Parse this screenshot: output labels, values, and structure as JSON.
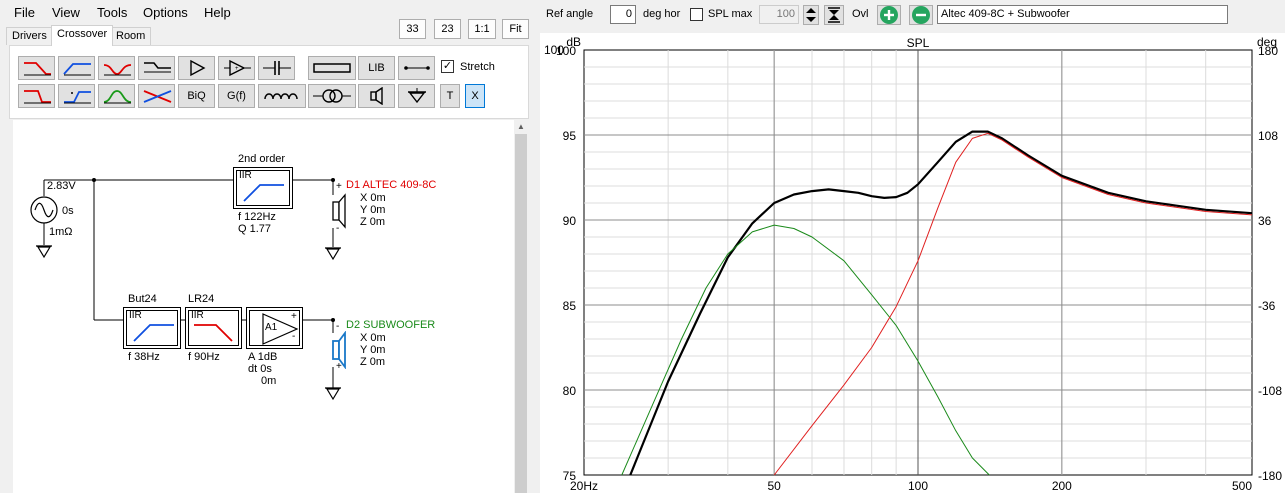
{
  "menu": {
    "file": "File",
    "view": "View",
    "tools": "Tools",
    "options": "Options",
    "help": "Help"
  },
  "small_buttons": {
    "zoom_a": "33",
    "zoom_b": "23",
    "one_to_one": "1:1",
    "fit": "Fit"
  },
  "tabs": [
    "Drivers",
    "Crossover",
    "Room"
  ],
  "toolbar": {
    "lib": "LIB",
    "biq": "BiQ",
    "gf": "G(f)",
    "t": "T",
    "x": "X",
    "stretch_label": "Stretch",
    "stretch_checked": true
  },
  "schematic": {
    "source_voltage": "2.83V",
    "source_delay": "0s",
    "source_resistance": "1mΩ",
    "filter1_title": "2nd order",
    "filter1_type": "IIR",
    "filter1_f": "f   122Hz",
    "filter1_q": "Q  1.77",
    "driver1_name": "D1 ALTEC 409-8C",
    "driver1_x": "X 0m",
    "driver1_y": "Y 0m",
    "driver1_z": "Z 0m",
    "filter2_title": "But24",
    "filter2_type": "IIR",
    "filter2_f": "f   38Hz",
    "filter3_title": "LR24",
    "filter3_type": "IIR",
    "filter3_f": "f   90Hz",
    "amp_label": "A1",
    "amp_gain": "A   1dB",
    "amp_dt": "dt 0s",
    "amp_dist": "0m",
    "driver2_name": "D2 SUBWOOFER",
    "driver2_x": "X 0m",
    "driver2_y": "Y 0m",
    "driver2_z": "Z 0m",
    "plus": "+",
    "minus": "-",
    "colors": {
      "driver1": "#e00000",
      "driver2": "#1a8a1a",
      "driver2_icon": "#1a78c8"
    }
  },
  "graph_toolbar": {
    "ref_angle_label": "Ref angle",
    "ref_angle_value": "0",
    "deg_hor_label": "deg hor",
    "spl_max_label": "SPL max",
    "spl_max_checked": false,
    "spl_max_value": "100",
    "ovl_label": "Ovl",
    "overlay_name": "Altec 409-8C + Subwoofer"
  },
  "chart_data": {
    "type": "line",
    "title": "SPL",
    "ylabel_left": "dB",
    "ylabel_right": "deg",
    "x_scale": "log",
    "xlim": [
      20,
      500
    ],
    "ylim": [
      75,
      100
    ],
    "y2lim": [
      -180,
      180
    ],
    "x_tick_labels": [
      "20Hz",
      "50",
      "100",
      "200",
      "500"
    ],
    "x_tick_values": [
      20,
      50,
      100,
      200,
      500
    ],
    "y_ticks": [
      75,
      80,
      85,
      90,
      95,
      100
    ],
    "y2_ticks": [
      -180,
      -108,
      -36,
      36,
      108,
      180
    ],
    "grid": true,
    "series": [
      {
        "color": "#000000",
        "x": [
          25,
          30,
          35,
          40,
          45,
          50,
          55,
          60,
          65,
          70,
          75,
          80,
          85,
          90,
          95,
          100,
          110,
          120,
          130,
          140,
          150,
          170,
          200,
          250,
          300,
          400,
          500
        ],
        "y": [
          75,
          80.5,
          84.5,
          87.8,
          89.8,
          91.0,
          91.5,
          91.7,
          91.8,
          91.7,
          91.6,
          91.4,
          91.3,
          91.35,
          91.6,
          92.1,
          93.4,
          94.6,
          95.2,
          95.2,
          94.8,
          93.8,
          92.6,
          91.6,
          91.1,
          90.6,
          90.4
        ]
      },
      {
        "color": "#1a8a1a",
        "x": [
          24,
          28,
          32,
          36,
          40,
          45,
          50,
          55,
          60,
          70,
          80,
          90,
          100,
          110,
          120,
          130,
          141
        ],
        "y": [
          75,
          79.3,
          83.0,
          86.0,
          88.0,
          89.3,
          89.7,
          89.5,
          89.0,
          87.6,
          85.6,
          83.8,
          81.7,
          79.6,
          77.6,
          76.0,
          75
        ]
      },
      {
        "color": "#e02020",
        "x": [
          50,
          60,
          70,
          80,
          90,
          100,
          110,
          120,
          130,
          140,
          150,
          170,
          200,
          250,
          300,
          400,
          500
        ],
        "y": [
          75,
          77.9,
          80.3,
          82.5,
          84.9,
          87.6,
          90.7,
          93.4,
          94.8,
          95.1,
          94.7,
          93.7,
          92.5,
          91.5,
          91.0,
          90.5,
          90.3
        ]
      }
    ]
  }
}
